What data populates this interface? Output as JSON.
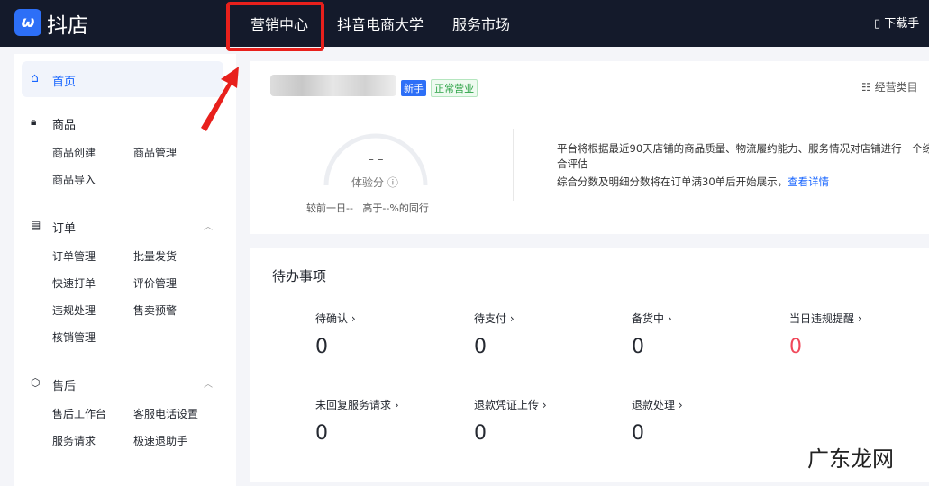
{
  "header": {
    "brand": "抖店",
    "logo_glyph": "ω",
    "nav": [
      "营销中心",
      "抖音电商大学",
      "服务市场"
    ],
    "download": "下载手"
  },
  "sidebar": {
    "home": "首页",
    "groups": [
      {
        "title": "商品",
        "items": [
          "商品创建",
          "商品管理",
          "商品导入"
        ]
      },
      {
        "title": "订单",
        "items": [
          "订单管理",
          "批量发货",
          "快速打单",
          "评价管理",
          "违规处理",
          "售卖预警",
          "核销管理"
        ]
      },
      {
        "title": "售后",
        "items": [
          "售后工作台",
          "客服电话设置",
          "服务请求",
          "极速退助手"
        ]
      }
    ]
  },
  "shop": {
    "tags": [
      "新手",
      "正常营业"
    ],
    "category_link": "经营类目",
    "score": "– –",
    "score_label": "体验分",
    "compare": "较前一日--   高于--%的同行",
    "desc1": "平台将根据最近90天店铺的商品质量、物流履约能力、服务情况对店铺进行一个综合评估",
    "desc2": "综合分数及明细分数将在订单满30单后开始展示，",
    "detail_link": "查看详情"
  },
  "todo": {
    "title": "待办事项",
    "items": [
      {
        "label": "待确认 ›",
        "value": "0"
      },
      {
        "label": "待支付 ›",
        "value": "0"
      },
      {
        "label": "备货中 ›",
        "value": "0"
      },
      {
        "label": "当日违规提醒 ›",
        "value": "0"
      },
      {
        "label": "未回复服务请求 ›",
        "value": "0"
      },
      {
        "label": "退款凭证上传 ›",
        "value": "0"
      },
      {
        "label": "退款处理 ›",
        "value": "0"
      }
    ]
  },
  "colors": {
    "accent": "#1966ff",
    "alert": "#f0485a",
    "highlight": "#e8201c"
  },
  "watermark": "广东龙网"
}
